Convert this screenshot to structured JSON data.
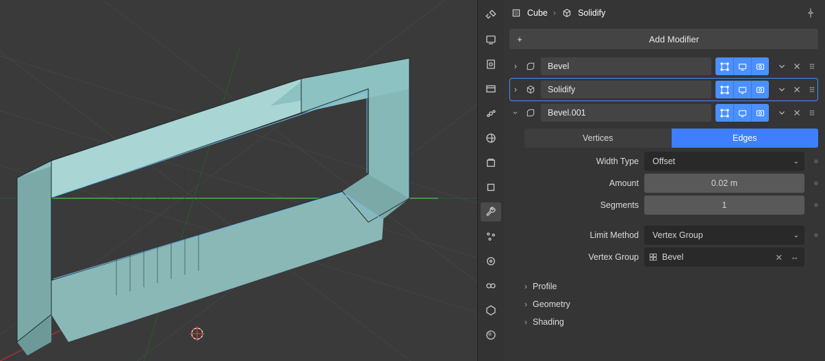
{
  "breadcrumb": {
    "object": "Cube",
    "modifier": "Solidify"
  },
  "add_modifier_label": "Add Modifier",
  "modifier_stack": [
    {
      "name": "Bevel",
      "expanded": false,
      "selected": false
    },
    {
      "name": "Solidify",
      "expanded": false,
      "selected": true
    },
    {
      "name": "Bevel.001",
      "expanded": true,
      "selected": false
    }
  ],
  "bevel_panel": {
    "tabs": {
      "left": "Vertices",
      "right": "Edges",
      "active": "Edges"
    },
    "width_type_label": "Width Type",
    "width_type_value": "Offset",
    "amount_label": "Amount",
    "amount_value": "0.02 m",
    "segments_label": "Segments",
    "segments_value": "1",
    "limit_method_label": "Limit Method",
    "limit_method_value": "Vertex Group",
    "vgroup_label": "Vertex Group",
    "vgroup_value": "Bevel",
    "subpanels": [
      "Profile",
      "Geometry",
      "Shading"
    ]
  }
}
